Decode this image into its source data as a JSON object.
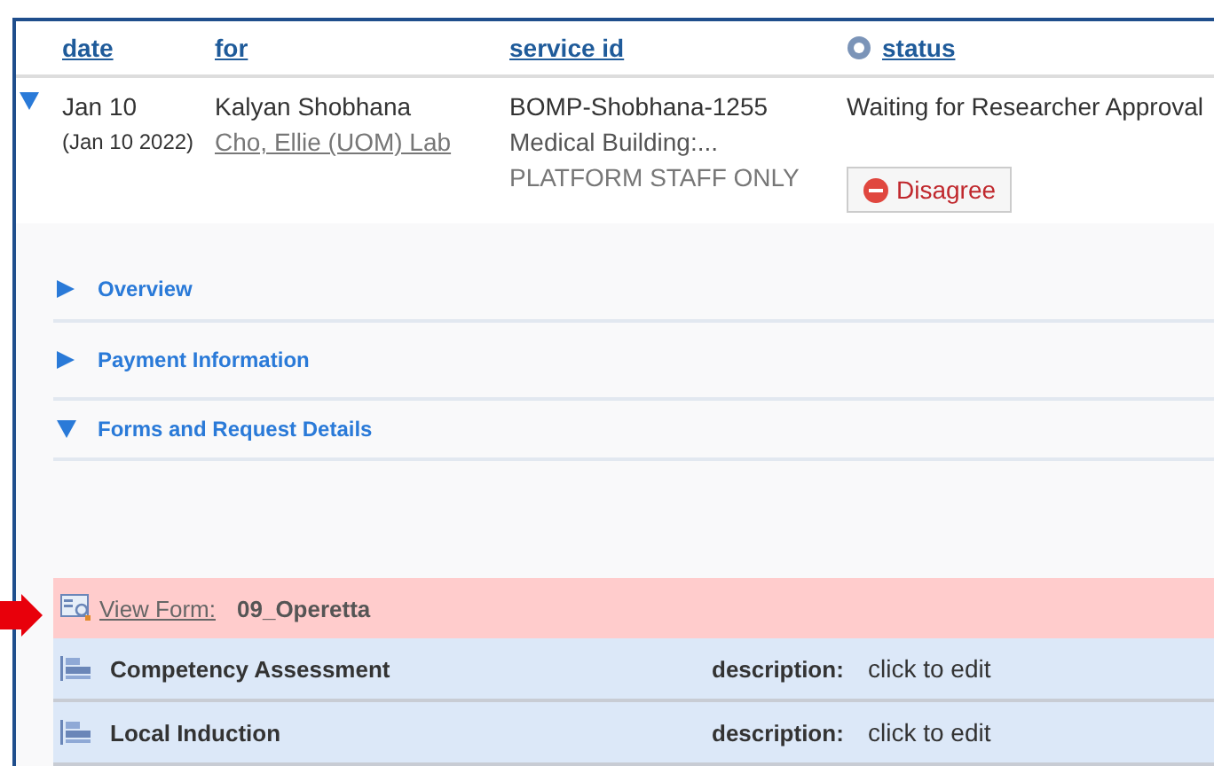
{
  "table": {
    "columns": [
      {
        "label": "date",
        "help": false
      },
      {
        "label": "for",
        "help": false
      },
      {
        "label": "service id",
        "help": false
      },
      {
        "label": "status",
        "help": true
      }
    ],
    "row": {
      "expanded": true,
      "date": "Jan 10",
      "date_full": "(Jan 10 2022)",
      "for_name": "Kalyan Shobhana",
      "for_lab": "Cho, Ellie (UOM) Lab",
      "service_lines": [
        "BOMP-Shobhana-1255",
        "Medical Building:..."
      ],
      "service_note": "PLATFORM STAFF ONLY",
      "status": "Waiting for Researcher Approval",
      "action": "Disagree"
    }
  },
  "sections": [
    {
      "label": "Overview",
      "expanded": false
    },
    {
      "label": "Payment Information",
      "expanded": false
    },
    {
      "label": "Forms and Request Details",
      "expanded": true
    }
  ],
  "form": {
    "link": "View Form:",
    "name": "09_Operetta",
    "items": [
      {
        "name": "Competency Assessment",
        "field": "description:",
        "value": "click to edit"
      },
      {
        "name": "Local Induction",
        "field": "description:",
        "value": "click to edit"
      }
    ]
  }
}
